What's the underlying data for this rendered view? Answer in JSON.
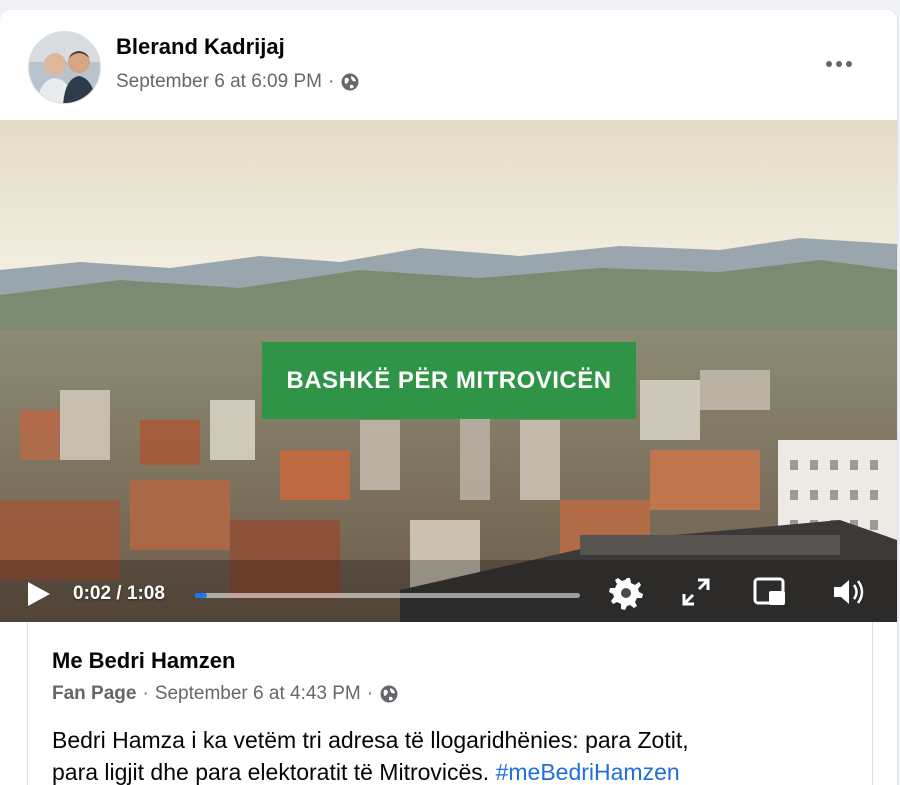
{
  "post": {
    "author": "Blerand Kadrijaj",
    "timestamp": "September 6 at 6:09 PM",
    "separator": "·",
    "privacy_icon": "globe-icon",
    "more_icon": "more-options-icon"
  },
  "video": {
    "banner_text": "BASHKË PËR MITROVICËN",
    "current_time": "0:02",
    "duration": "1:08",
    "time_display": "0:02 / 1:08",
    "progress_fraction": 0.03,
    "icons": [
      "play-icon",
      "settings-gear-icon",
      "fullscreen-icon",
      "picture-in-picture-icon",
      "volume-icon"
    ]
  },
  "shared": {
    "page_name": "Me Bedri Hamzen",
    "page_type": "Fan Page",
    "timestamp": "September 6 at 4:43 PM",
    "separator": "·",
    "text_line1": "Bedri Hamza i ka vetëm tri adresa të llogaridhënies: para Zotit,",
    "text_line2": "para ligjit dhe para elektoratit të Mitrovicës.",
    "hashtag": "#meBedriHamzen"
  },
  "colors": {
    "accent": "#1877f2",
    "hashtag": "#216fdb",
    "banner": "#2f9445",
    "secondary_text": "#65676b"
  }
}
